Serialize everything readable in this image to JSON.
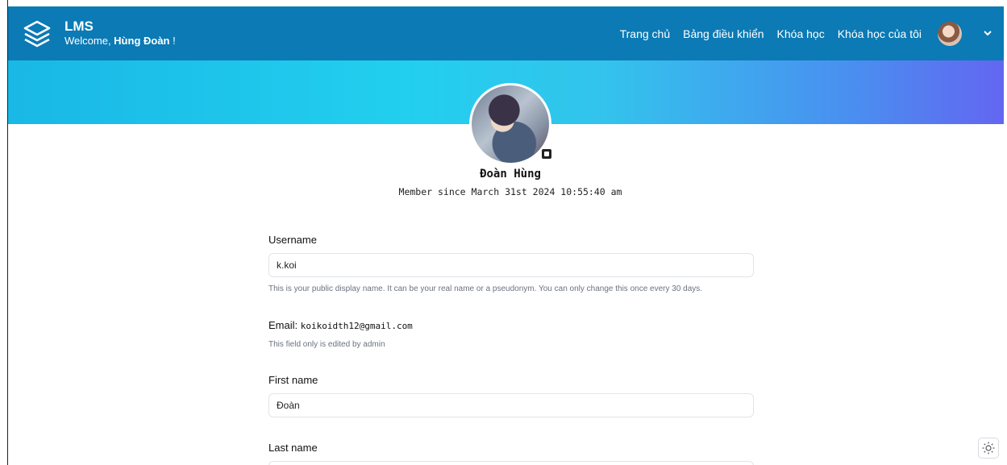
{
  "header": {
    "brand": "LMS",
    "welcome_prefix": "Welcome, ",
    "user_name": "Hùng Đoàn",
    "welcome_suffix": " !",
    "nav": [
      "Trang chủ",
      "Bảng điều khiển",
      "Khóa học",
      "Khóa học của tôi"
    ]
  },
  "profile": {
    "name": "Đoàn Hùng",
    "member_since": "Member since March 31st 2024 10:55:40 am"
  },
  "form": {
    "username_label": "Username",
    "username_value": "k.koi",
    "username_help": "This is your public display name. It can be your real name or a pseudonym. You can only change this once every 30 days.",
    "email_label": "Email: ",
    "email_value": "koikoidth12@gmail.com",
    "email_help": "This field only is edited by admin",
    "first_name_label": "First name",
    "first_name_value": "Đoàn",
    "last_name_label": "Last name"
  },
  "colors": {
    "navbar": "#0b7ab5",
    "banner_start": "#19b8e6",
    "banner_end": "#6366f1"
  },
  "icons": {
    "logo": "layers-icon",
    "edit": "edit-avatar-icon",
    "dropdown": "chevron-down-icon",
    "theme": "sun-icon"
  }
}
